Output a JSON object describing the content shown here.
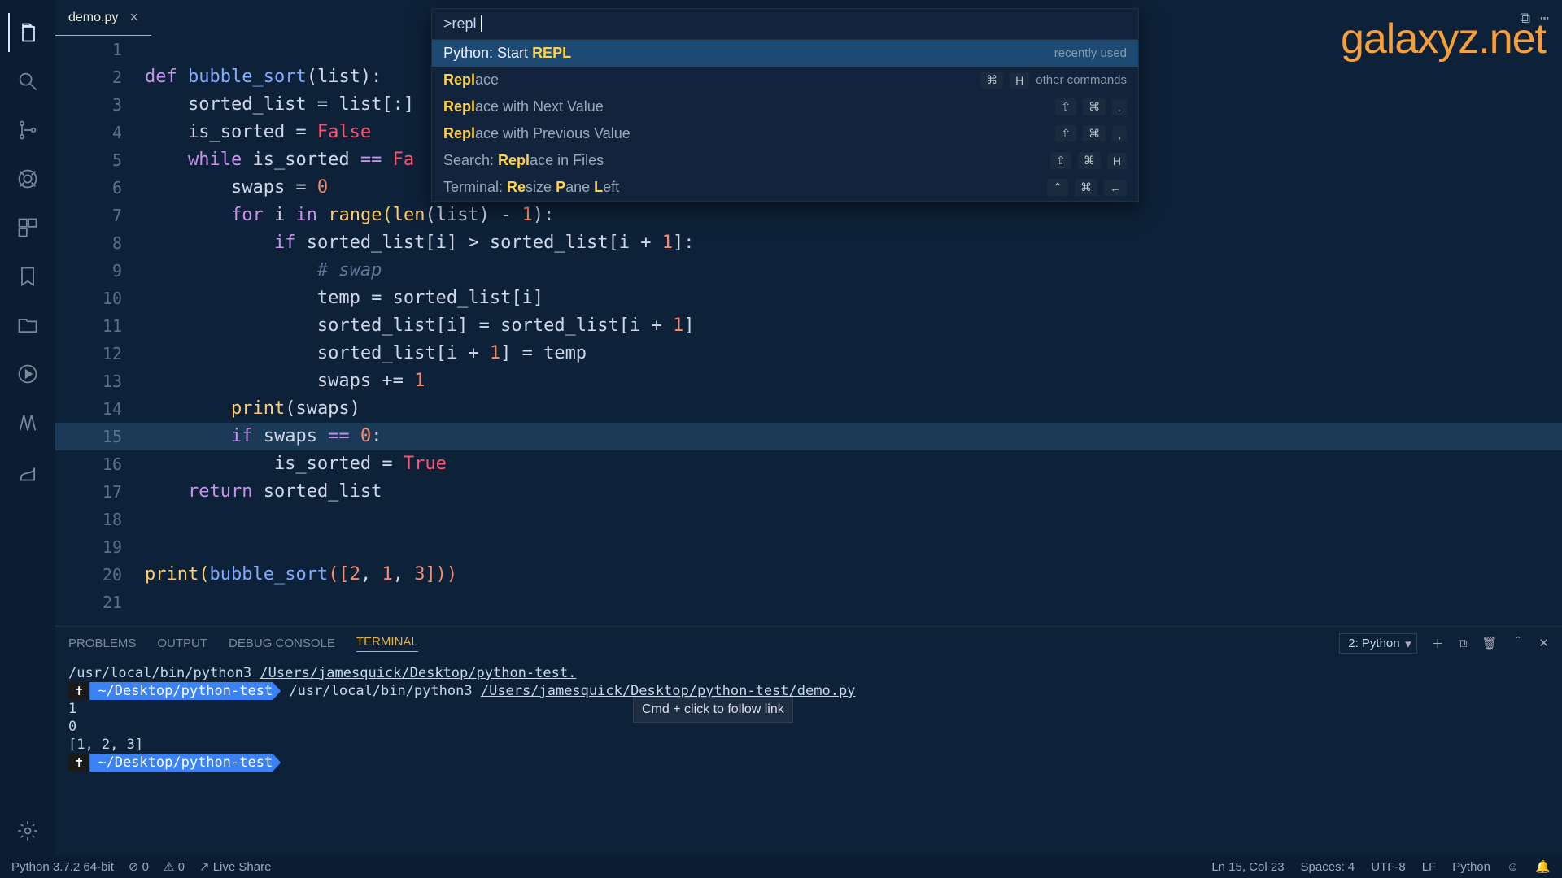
{
  "watermark": "galaxyz.net",
  "tab": {
    "name": "demo.py",
    "close": "×"
  },
  "gutter_lines": [
    "1",
    "2",
    "3",
    "4",
    "5",
    "6",
    "7",
    "8",
    "9",
    "10",
    "11",
    "12",
    "13",
    "14",
    "15",
    "16",
    "17",
    "18",
    "19",
    "20",
    "21"
  ],
  "code": {
    "l1": "",
    "l2_def": "def",
    "l2_fn": "bubble_sort",
    "l2_rest": "(list):",
    "l3_a": "    sorted_list = list[:]",
    "l4_a": "    is_sorted = ",
    "l4_b": "False",
    "l5_a": "    ",
    "l5_while": "while",
    "l5_b": " is_sorted ",
    "l5_eq": "==",
    "l5_c": " Fa",
    "l6": "        swaps = ",
    "l6n": "0",
    "l7": "        ",
    "l7for": "for",
    "l7b": " i ",
    "l7in": "in",
    "l7c": " ",
    "l7range": "range",
    "l7d": "(",
    "l7len": "len",
    "l7e": "(list) - ",
    "l7n": "1",
    "l7f": "):",
    "l8": "            ",
    "l8if": "if",
    "l8b": " sorted_list[i] > sorted_list[i + ",
    "l8n": "1",
    "l8c": "]:",
    "l9": "                ",
    "l9c": "# swap",
    "l10": "                temp = sorted_list[i]",
    "l11": "                sorted_list[i] = sorted_list[i + ",
    "l11n": "1",
    "l11b": "]",
    "l12": "                sorted_list[i + ",
    "l12n": "1",
    "l12b": "] = temp",
    "l13": "                swaps += ",
    "l13n": "1",
    "l14": "        ",
    "l14print": "print",
    "l14b": "(swaps)",
    "l15": "        ",
    "l15if": "if",
    "l15b": " swaps ",
    "l15eq": "==",
    "l15c": " ",
    "l15n": "0",
    "l15d": ":",
    "l16": "            is_sorted = ",
    "l16b": "True",
    "l17": "    ",
    "l17ret": "return",
    "l17b": " sorted_list",
    "l20a": "print",
    "l20b": "(",
    "l20c": "bubble_sort",
    "l20d": "([",
    "l20n1": "2",
    "l20s1": ", ",
    "l20n2": "1",
    "l20s2": ", ",
    "l20n3": "3",
    "l20e": "]))"
  },
  "palette": {
    "input": ">repl",
    "items": [
      {
        "pre": "Python: Start ",
        "match": "REPL",
        "post": "",
        "right_label": "recently used",
        "keys": []
      },
      {
        "pre": "",
        "match": "Repl",
        "post": "ace",
        "right_label": "other commands",
        "keys": [
          "⌘",
          "H"
        ]
      },
      {
        "pre": "",
        "match": "Repl",
        "post": "ace with Next Value",
        "right_label": "",
        "keys": [
          "⇧",
          "⌘",
          "."
        ]
      },
      {
        "pre": "",
        "match": "Repl",
        "post": "ace with Previous Value",
        "right_label": "",
        "keys": [
          "⇧",
          "⌘",
          ","
        ]
      },
      {
        "pre": "Search: ",
        "match": "Repl",
        "post": "ace in Files",
        "right_label": "",
        "keys": [
          "⇧",
          "⌘",
          "H"
        ]
      },
      {
        "pre": "Terminal: ",
        "match": "Re",
        "post": "size ",
        "match2": "P",
        "post2": "ane ",
        "match3": "L",
        "post3": "eft",
        "right_label": "",
        "keys": [
          "⌃",
          "⌘",
          "←"
        ]
      }
    ]
  },
  "panel": {
    "tabs": [
      "PROBLEMS",
      "OUTPUT",
      "DEBUG CONSOLE",
      "TERMINAL"
    ],
    "terminal_selector": "2: Python",
    "line1_a": "/usr/local/bin/python3 ",
    "line1_b": "/Users/jamesquick/Desktop/python-test.",
    "prompt_symbol": "✝",
    "prompt_path": " ~/Desktop/python-test ",
    "line2": "/usr/local/bin/python3 ",
    "line2b": "/Users/jamesquick/Desktop/python-test/demo.py",
    "out1": "1",
    "out2": "0",
    "out3": "[1, 2, 3]",
    "tooltip": "Cmd + click to follow link"
  },
  "status": {
    "python": "Python 3.7.2 64-bit",
    "errors": "⊘ 0",
    "warnings": "⚠ 0",
    "liveshare": "↗ Live Share",
    "ln": "Ln 15, Col 23",
    "spaces": "Spaces: 4",
    "encoding": "UTF-8",
    "eol": "LF",
    "lang": "Python",
    "smile": "☺",
    "bell": "🔔"
  },
  "title_actions": {
    "split": "⧉",
    "more": "⋯"
  }
}
